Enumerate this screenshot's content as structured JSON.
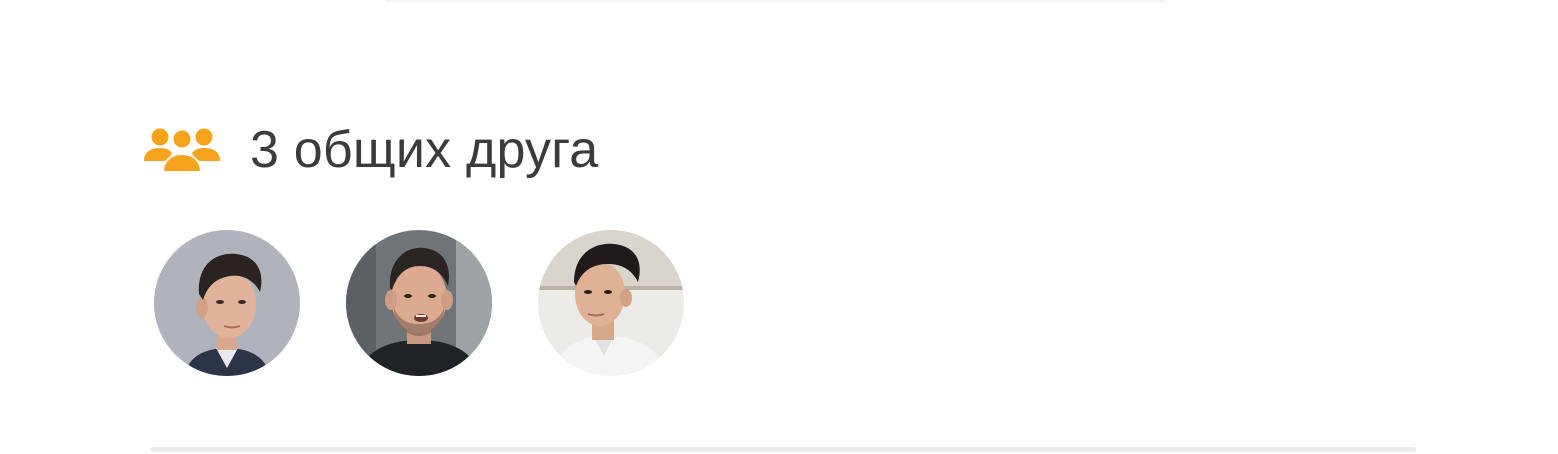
{
  "mutual_friends": {
    "title": "3 общих друга",
    "icon": "friends-group-icon",
    "icon_color": "#f7a21b",
    "friends": [
      {
        "avatar": "friend-avatar-1"
      },
      {
        "avatar": "friend-avatar-2"
      },
      {
        "avatar": "friend-avatar-3"
      }
    ]
  }
}
